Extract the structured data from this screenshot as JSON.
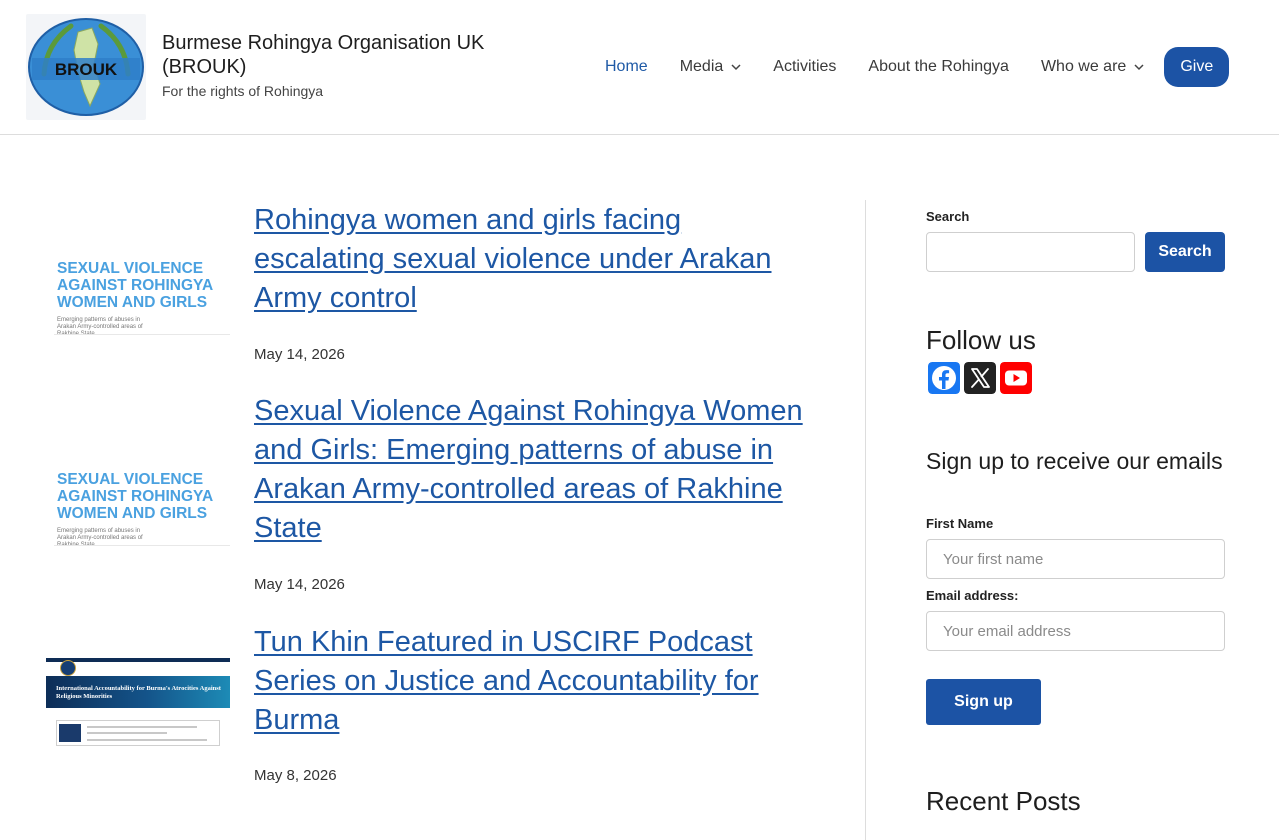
{
  "header": {
    "logo_text": "BROUK",
    "site_title": "Burmese Rohingya Organisation UK (BROUK)",
    "tagline": "For the rights of Rohingya"
  },
  "nav": {
    "home": "Home",
    "media": "Media",
    "activities": "Activities",
    "about": "About the Rohingya",
    "who": "Who we are",
    "give": "Give"
  },
  "posts": [
    {
      "title": "Rohingya women and girls facing escalating sexual violence under Arakan Army control",
      "date": "May 14, 2026",
      "thumb_lines": [
        "SEXUAL VIOLENCE",
        "AGAINST ROHINGYA",
        "WOMEN AND GIRLS"
      ],
      "thumb_sub": "Emerging patterns of abuses in Arakan Army-controlled areas of Rakhine State"
    },
    {
      "title": "Sexual Violence Against Rohingya Women and Girls: Emerging patterns of abuse in Arakan Army-controlled areas of Rakhine State",
      "date": "May 14, 2026",
      "thumb_lines": [
        "SEXUAL VIOLENCE",
        "AGAINST ROHINGYA",
        "WOMEN AND GIRLS"
      ],
      "thumb_sub": "Emerging patterns of abuses in Arakan Army-controlled areas of Rakhine State"
    },
    {
      "title": "Tun Khin Featured in USCIRF Podcast Series on Justice and Accountability for Burma",
      "date": "May 8, 2026",
      "thumb_banner": "International Accountability for Burma's Atrocities Against Religious Minorities"
    }
  ],
  "sidebar": {
    "search_label": "Search",
    "search_button": "Search",
    "follow_title": "Follow us",
    "social": [
      "facebook-icon",
      "x-icon",
      "youtube-icon"
    ],
    "signup_title": "Sign up to receive our emails",
    "first_name_label": "First Name",
    "first_name_placeholder": "Your first name",
    "email_label": "Email address:",
    "email_placeholder": "Your email address",
    "signup_button": "Sign up",
    "recent_title": "Recent Posts"
  },
  "colors": {
    "accent": "#1c53a5",
    "link": "#1d57a4",
    "thumb_text": "#4aa1e0",
    "facebook": "#1877f2",
    "x": "#222222",
    "youtube": "#ff0000"
  }
}
